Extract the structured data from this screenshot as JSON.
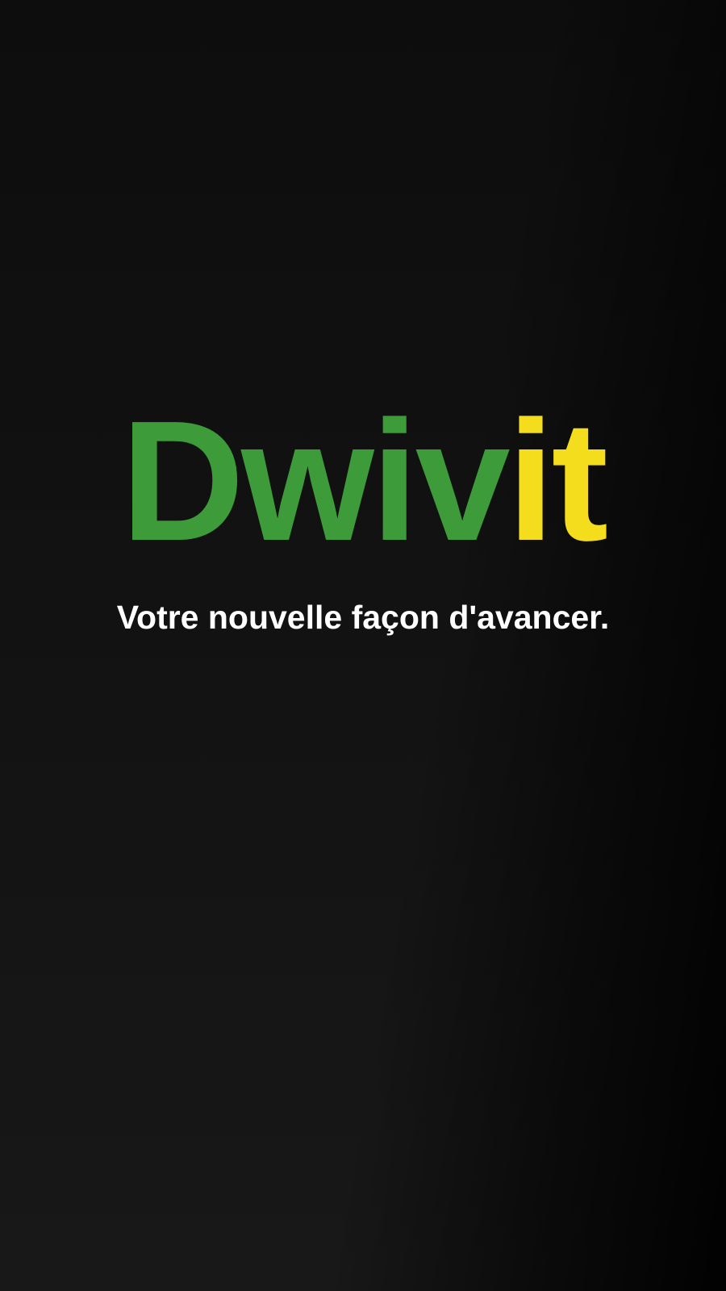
{
  "splash": {
    "logo": {
      "part_1": "Dwiv",
      "part_2": "it"
    },
    "tagline": "Votre nouvelle façon d'avancer."
  },
  "colors": {
    "logo_green": "#3d9c39",
    "logo_yellow": "#f4dd1c",
    "tagline": "#ffffff",
    "background": "#141414"
  }
}
